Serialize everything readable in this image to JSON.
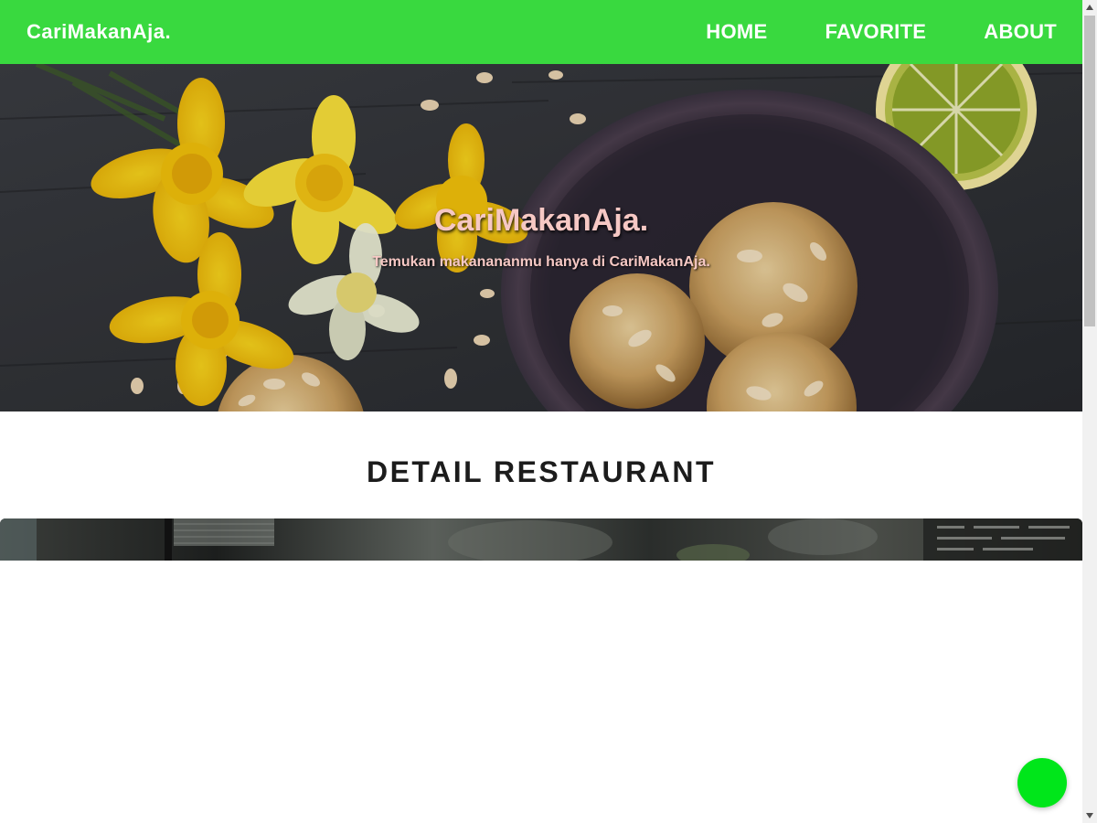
{
  "navbar": {
    "brand": "CariMakanAja.",
    "links": [
      {
        "label": "HOME"
      },
      {
        "label": "FAVORITE"
      },
      {
        "label": "ABOUT"
      }
    ],
    "background_color": "#39d93f"
  },
  "hero": {
    "title": "CariMakanAja.",
    "tagline": "Temukan makanananmu hanya di CariMakanAja."
  },
  "main": {
    "section_title": "DETAIL RESTAURANT"
  },
  "fab": {
    "color": "#00e61a",
    "icon": "heart-icon"
  },
  "scrollbar": {
    "up_icon": "triangle-up-icon",
    "down_icon": "triangle-down-icon"
  }
}
